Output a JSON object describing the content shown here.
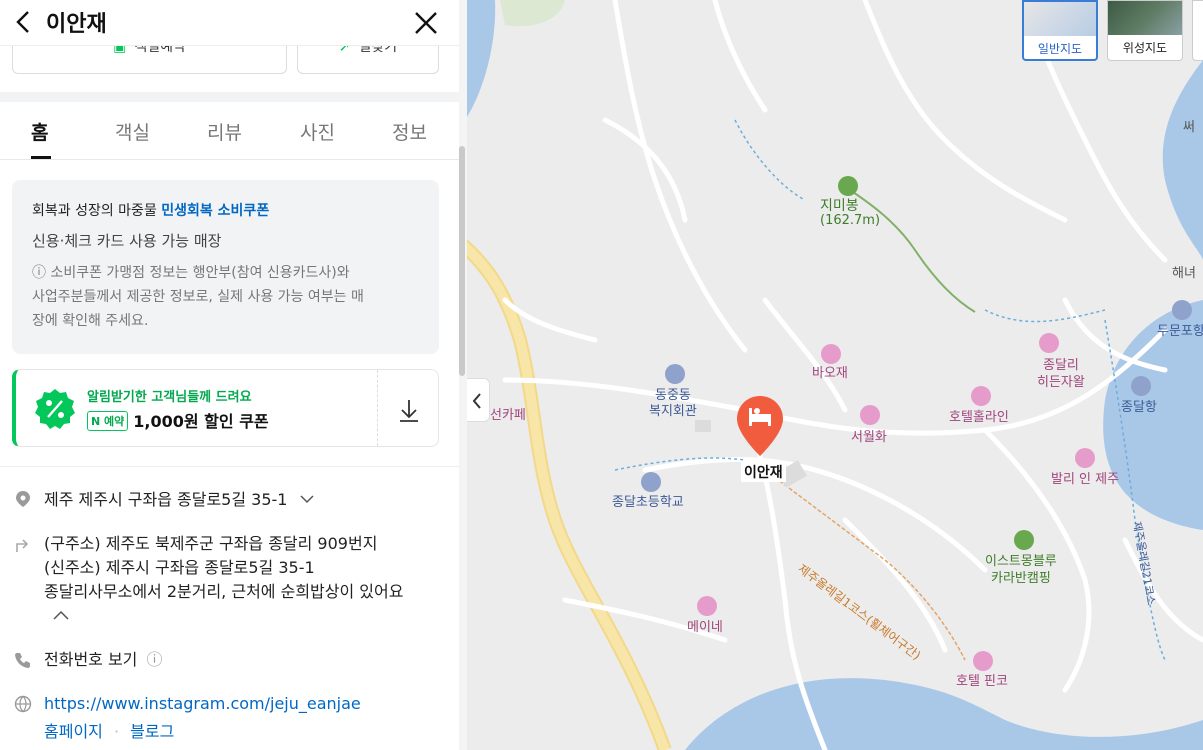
{
  "panel": {
    "title": "이안재",
    "actions": {
      "left_label": "객실예약",
      "right_label": "길찾기"
    },
    "tabs": [
      "홈",
      "객실",
      "리뷰",
      "사진",
      "정보"
    ],
    "coupon": {
      "line1_prefix": "회복과 성장의 마중물 ",
      "line1_highlight": "민생회복 소비쿠폰",
      "line2": "신용·체크 카드 사용 가능 매장",
      "note_lines": [
        "ⓘ 소비쿠폰 가맹점 정보는 행안부(참여 신용카드사)와",
        "사업주분들께서 제공한 정보로, 실제 사용 가능 여부는 매",
        "장에 확인해 주세요."
      ]
    },
    "download_coupon": {
      "title": "알림받기한 고객님들께 드려요",
      "pill": "N 예약",
      "amount": "1,000원 할인 쿠폰"
    },
    "address": {
      "road": "제주 제주시 구좌읍 종달로5길 35-1",
      "old": "(구주소) 제주도 북제주군 구좌읍 종달리 909번지",
      "new": "(신주소) 제주시 구좌읍 종달로5길 35-1",
      "direction": "종달리사무소에서 2분거리, 근처에 순희밥상이 있어요"
    },
    "phone_label": "전화번호 보기",
    "website": "https://www.instagram.com/jeju_eanjae",
    "links": {
      "homepage": "홈페이지",
      "blog": "블로그"
    }
  },
  "map": {
    "labels": {
      "mountain": "지미봉",
      "mountain_height": "(162.7m)",
      "baojae": "바오재",
      "dongjungdong1": "동중동",
      "dongjungdong2": "복지회관",
      "cafe": "선카페",
      "hotel_hollaine": "호텔홀라인",
      "seowolhwa": "서월화",
      "selected": "이안재",
      "school": "종달초등학교",
      "jongdal_hidden1": "종달리",
      "jongdal_hidden2": "히든자왈",
      "jongdal_port": "종달항",
      "bali_inn": "발리 인 제주",
      "east_camping1": "이스트몽블루",
      "east_camping2": "카라반캠핑",
      "meine": "메이네",
      "hotel_pinko": "호텔 핀코",
      "olle_route": "제주올레길1코스(휠체어구간)",
      "olle_route2": "제주올레길21코스",
      "dumun": "두문포항",
      "haena": "해녀",
      "ssi": "써"
    },
    "maptypes": {
      "normal": "일반지도",
      "satellite": "위성지도"
    }
  }
}
